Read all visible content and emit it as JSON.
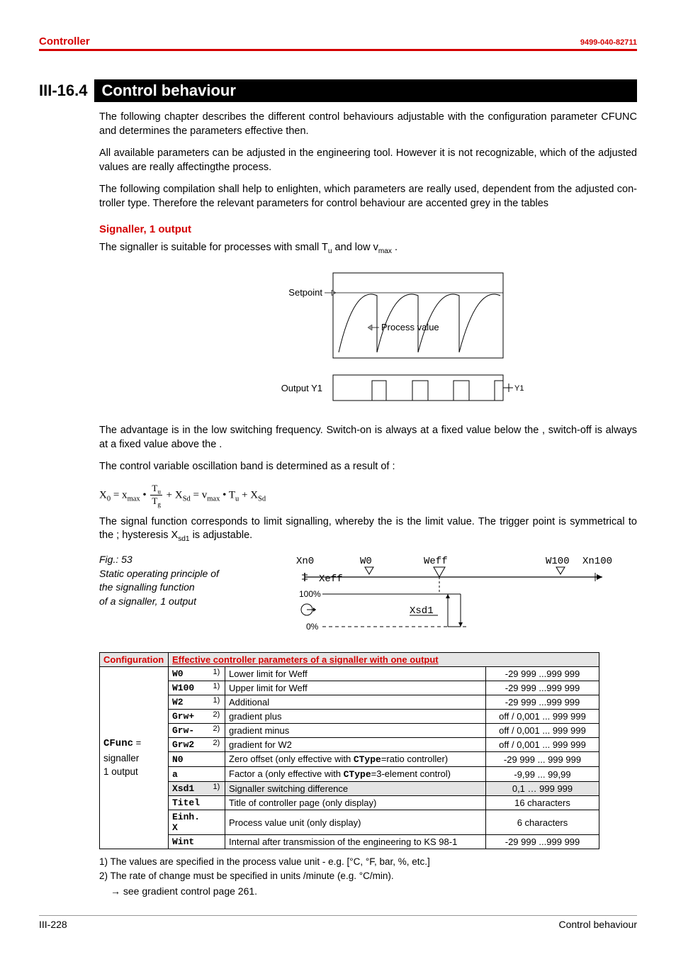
{
  "header": {
    "left": "Controller",
    "right": "9499-040-82711"
  },
  "section": {
    "num": "III-16.4",
    "title": "Control behaviour"
  },
  "paras": {
    "p1": "The following chapter describes the different control behaviours adjustable with the configuration parameter CFUNC and determines the parameters effective then.",
    "p2": "All available parameters can be adjusted in the engineering tool. However it is not recognizable, which of the adjusted values are really affectingthe process.",
    "p3": "The following compilation shall help to enlighten, which parameters are really used, dependent from the adjusted con­troller type. Therefore the relevant parameters for control behaviour are accented grey in the tables",
    "subhead": "Signaller, 1 output",
    "p4a": "The signaller is suitable for processes with small T",
    "p4b": " and low v",
    "p4c": " .",
    "sub_u": "u",
    "sub_max": "max",
    "p5": "The advantage is in the low switching frequency. Switch-on is always at a fixed value below the , switch-off is always at a fixed value above the .",
    "p6": "The control variable oscillation band is determined as a result of :",
    "p7a": "The signal function corresponds to limit signalling, whereby the  is the limit value. The trigger point is symmetrical to the ; hysteresis X",
    "p7b": " is adjustable.",
    "sub_sd1": "sd1"
  },
  "fig1": {
    "setpoint": "Setpoint",
    "process": "Process value",
    "output": "Output Y1",
    "y1": "Y1"
  },
  "formula": {
    "lhs": "X",
    "sub0": "0",
    "eq": " = x",
    "submax": "max",
    "dot": " • ",
    "num": "T",
    "numsub": "u",
    "den": "T",
    "densub": "g",
    "plus": " + X",
    "subSd": "Sd",
    "mid": "  =  v",
    "dot2": " • T",
    "plus2": " + X"
  },
  "fig53": {
    "num": "Fig.: 53",
    "line1": "Static operating principle of",
    "line2": "the signalling function",
    "line3": "of a signaller, 1 output",
    "xn0": "Xn0",
    "w0": "W0",
    "weff": "Weff",
    "w100": "W100",
    "xn100": "Xn100",
    "xeff": "Xeff",
    "p100": "100%",
    "p0": "0%",
    "xsd1": "Xsd1"
  },
  "table": {
    "h1": "Configuration",
    "h2": "Effective controller parameters of a signaller with one output",
    "rows": [
      {
        "code": "W0",
        "sup": "1)",
        "desc": "Lower  limit for Weff",
        "range": "-29 999 ...999 999",
        "hi": false
      },
      {
        "code": "W100",
        "sup": "1)",
        "desc": "Upper  limit for Weff",
        "range": "-29 999 ...999 999",
        "hi": false
      },
      {
        "code": "W2",
        "sup": "1)",
        "desc": "Additional",
        "range": "-29 999 ...999 999",
        "hi": false
      },
      {
        "code": "Grw+",
        "sup": "2)",
        "desc": "gradient plus",
        "range": "off / 0,001 ... 999 999",
        "hi": false
      },
      {
        "code": "Grw-",
        "sup": "2)",
        "desc": "gradient minus",
        "range": "off / 0,001 ... 999 999",
        "hi": false
      },
      {
        "code": "Grw2",
        "sup": "2)",
        "desc": "gradient for W2",
        "range": "off / 0,001 ... 999 999",
        "hi": false
      },
      {
        "code": "N0",
        "sup": "",
        "desc": "Zero offset (only effective with CType=ratio controller)",
        "range": "-29 999 ... 999 999",
        "hi": false
      },
      {
        "code": "a",
        "sup": "",
        "desc": "Factor a (only effective with CType=3-element control)",
        "range": "-9,99 ... 99,99",
        "hi": false
      },
      {
        "code": "Xsd1",
        "sup": "1)",
        "desc": "Signaller switching difference",
        "range": "0,1 … 999 999",
        "hi": true
      },
      {
        "code": "Titel",
        "sup": "",
        "desc": "Title of controller page (only display)",
        "range": "16 characters",
        "hi": false
      },
      {
        "code": "Einh. X",
        "sup": "",
        "desc": "Process value unit (only display)",
        "range": "6 characters",
        "hi": false
      },
      {
        "code": "Wint",
        "sup": "",
        "desc": "Internal  after transmission of the engineering to KS 98-1",
        "range": "-29 999 ...999 999",
        "hi": false
      }
    ],
    "cfunc_code": "CFunc",
    "cfunc_eq": " = ",
    "cfunc_text": "signaller, 1 output"
  },
  "footnotes": {
    "f1": "1) The values are specified in the process value unit - e.g. [°C, °F, bar, %, etc.]",
    "f2": "2) The rate of change must be specified in units /minute (e.g. °C/min).",
    "f3": "→ see gradient control page 261."
  },
  "footer": {
    "left": "III-228",
    "right": "Control behaviour"
  }
}
